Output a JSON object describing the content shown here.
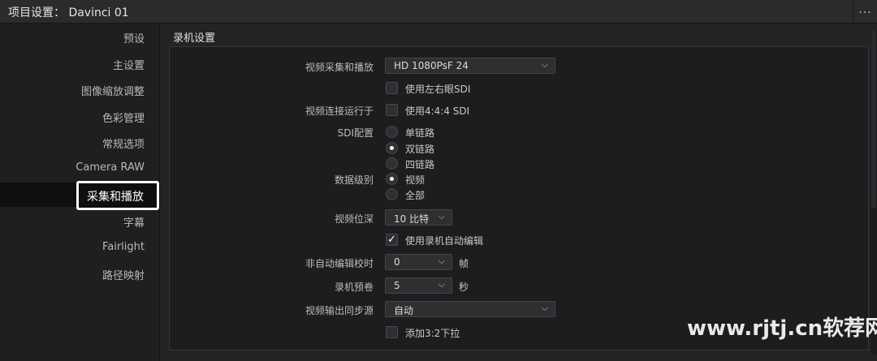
{
  "window": {
    "title": "项目设置：  Davinci 01",
    "more_icon": "…"
  },
  "sidebar": {
    "items": [
      {
        "label": "预设"
      },
      {
        "label": "主设置"
      },
      {
        "label": "图像缩放调整"
      },
      {
        "label": "色彩管理"
      },
      {
        "label": "常规选项"
      },
      {
        "label": "Camera RAW"
      },
      {
        "label": "采集和播放",
        "active": true
      },
      {
        "label": "字幕"
      },
      {
        "label": "Fairlight"
      },
      {
        "label": "路径映射"
      }
    ]
  },
  "main": {
    "section_title": "录机设置",
    "video_capture_playback": {
      "label": "视频采集和播放",
      "value": "HD 1080PsF 24"
    },
    "use_stereo_sdi": {
      "label": "使用左右眼SDI",
      "checked": false
    },
    "video_connection": {
      "label": "视频连接运行于",
      "option_label": "使用4:4:4 SDI",
      "checked": false
    },
    "sdi_config": {
      "label": "SDI配置",
      "options": [
        {
          "label": "单链路",
          "selected": false
        },
        {
          "label": "双链路",
          "selected": true
        },
        {
          "label": "四链路",
          "selected": false
        }
      ]
    },
    "data_levels": {
      "label": "数据级别",
      "options": [
        {
          "label": "视频",
          "selected": true
        },
        {
          "label": "全部",
          "selected": false
        }
      ]
    },
    "bit_depth": {
      "label": "视频位深",
      "value": "10 比特"
    },
    "use_deck_autoedit": {
      "label": "使用录机自动编辑",
      "checked": true
    },
    "non_auto_edit_timing": {
      "label": "非自动编辑校时",
      "value": "0",
      "unit": "帧"
    },
    "deck_preroll": {
      "label": "录机预卷",
      "value": "5",
      "unit": "秒"
    },
    "video_output_sync": {
      "label": "视频输出同步源",
      "value": "自动"
    },
    "add_pulldown": {
      "label": "添加3:2下拉",
      "checked": false
    },
    "chevron_icon": "⌵",
    "check_icon": "✓"
  },
  "watermark": {
    "text": "www.rjtj.cn软荐网"
  },
  "colors": {
    "background": "#1f1f21",
    "panel": "#1d1d1f",
    "active_item": "#0f0f10",
    "highlight_border": "#ffffff"
  }
}
